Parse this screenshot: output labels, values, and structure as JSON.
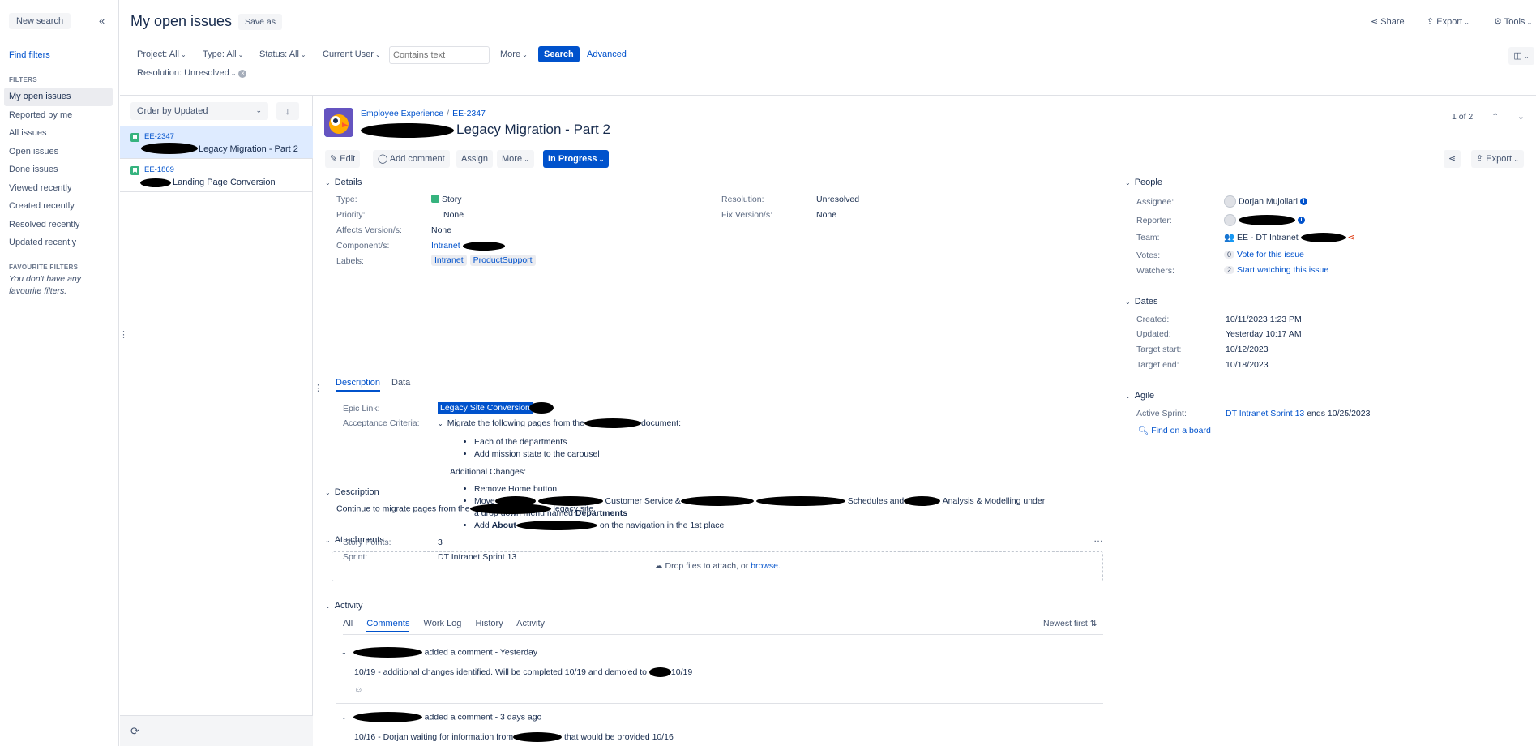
{
  "sidebar": {
    "new_search": "New search",
    "find_filters": "Find filters",
    "filters_heading": "FILTERS",
    "filters": [
      "My open issues",
      "Reported by me",
      "All issues",
      "Open issues",
      "Done issues",
      "Viewed recently",
      "Created recently",
      "Resolved recently",
      "Updated recently"
    ],
    "favourite_heading": "FAVOURITE FILTERS",
    "favourite_empty": "You don't have any favourite filters."
  },
  "header": {
    "title": "My open issues",
    "save_as": "Save as",
    "share": "Share",
    "export": "Export",
    "tools": "Tools",
    "criteria": {
      "project": "Project: All",
      "type": "Type: All",
      "status": "Status: All",
      "user": "Current User",
      "text_placeholder": "Contains text",
      "more": "More",
      "search": "Search",
      "advanced": "Advanced",
      "resolution": "Resolution: Unresolved"
    }
  },
  "list": {
    "order_by": "Order by Updated",
    "items": [
      {
        "key": "EE-2347",
        "summary": "Legacy Migration - Part 2"
      },
      {
        "key": "EE-1869",
        "summary": "Landing Page Conversion"
      }
    ]
  },
  "issue": {
    "project": "Employee Experience",
    "key": "EE-2347",
    "title": "Legacy Migration - Part 2",
    "pager": "1 of 2",
    "toolbar": {
      "edit": "Edit",
      "add_comment": "Add comment",
      "assign": "Assign",
      "more": "More",
      "status": "In Progress",
      "export": "Export"
    },
    "details": {
      "heading": "Details",
      "type_label": "Type:",
      "type": "Story",
      "priority_label": "Priority:",
      "priority": "None",
      "affects_label": "Affects Version/s:",
      "affects": "None",
      "component_label": "Component/s:",
      "component": "Intranet",
      "labels_label": "Labels:",
      "labels": [
        "Intranet",
        "ProductSupport"
      ],
      "resolution_label": "Resolution:",
      "resolution": "Unresolved",
      "fix_label": "Fix Version/s:",
      "fix": "None"
    },
    "tabs": [
      "Description",
      "Data"
    ],
    "custom": {
      "epic_label": "Epic Link:",
      "epic": "Legacy Site Conversion",
      "ac_label": "Acceptance Criteria:",
      "ac_intro_a": "Migrate the following pages from the",
      "ac_intro_b": "document:",
      "ac_list1": [
        "Each of the departments",
        "Add mission state to the carousel"
      ],
      "ac_additional": "Additional Changes:",
      "ac_remove": "Remove Home button",
      "ac_move_a": "Move",
      "ac_move_b": "Customer Service &",
      "ac_move_c": "Schedules and",
      "ac_move_d": "Analysis & Modelling under",
      "ac_move_e": "a drop down menu named",
      "ac_move_bold": "Departments",
      "ac_add_a": "Add",
      "ac_add_bold": "About",
      "ac_add_b": "on the navigation in the 1st place",
      "sp_label": "Story Points:",
      "sp": "3",
      "sprint_label": "Sprint:",
      "sprint": "DT Intranet Sprint 13"
    },
    "description": {
      "heading": "Description",
      "text_a": "Continue to migrate pages from the",
      "text_b": "legacy site."
    },
    "attachments": {
      "heading": "Attachments",
      "drop_text": "Drop files to attach, or",
      "browse": "browse."
    },
    "activity": {
      "heading": "Activity",
      "tabs": [
        "All",
        "Comments",
        "Work Log",
        "History",
        "Activity"
      ],
      "sort": "Newest first",
      "comments": [
        {
          "meta": "added a comment - Yesterday",
          "body_a": "10/19 - additional changes identified. Will be completed 10/19 and demo'ed to",
          "body_b": "10/19"
        },
        {
          "meta": "added a comment - 3 days ago",
          "body_a": "10/16 - Dorjan waiting for information from",
          "body_b": "that would be provided 10/16"
        }
      ]
    },
    "people": {
      "heading": "People",
      "assignee_label": "Assignee:",
      "assignee": "Dorjan Mujollari",
      "reporter_label": "Reporter:",
      "team_label": "Team:",
      "team": "EE - DT Intranet",
      "votes_label": "Votes:",
      "votes_count": "0",
      "votes_link": "Vote for this issue",
      "watchers_label": "Watchers:",
      "watchers_count": "2",
      "watchers_link": "Start watching this issue"
    },
    "dates": {
      "heading": "Dates",
      "created_label": "Created:",
      "created": "10/11/2023 1:23 PM",
      "updated_label": "Updated:",
      "updated": "Yesterday 10:17 AM",
      "start_label": "Target start:",
      "start": "10/12/2023",
      "end_label": "Target end:",
      "end": "10/18/2023"
    },
    "agile": {
      "heading": "Agile",
      "sprint_label": "Active Sprint:",
      "sprint_link": "DT Intranet Sprint 13",
      "sprint_ends": "ends 10/25/2023",
      "find_board": "Find on a board"
    }
  }
}
